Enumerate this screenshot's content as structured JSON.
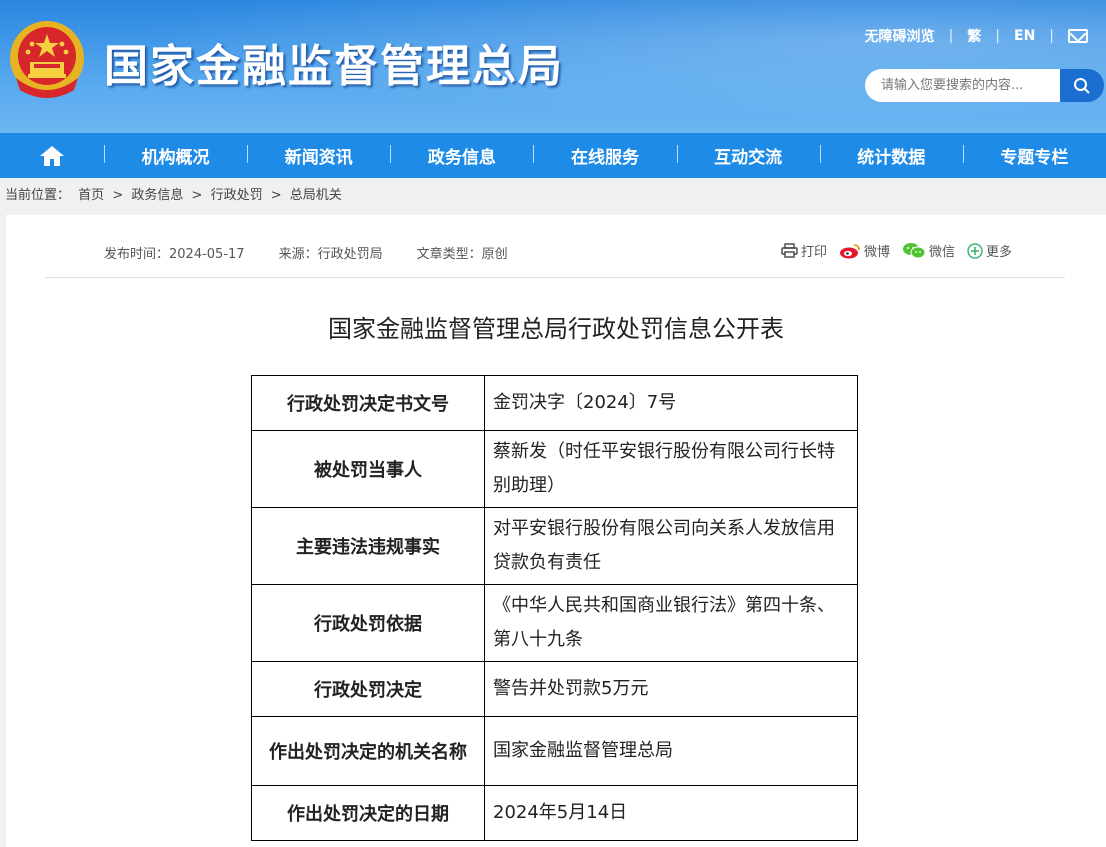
{
  "header": {
    "site_title": "国家金融监督管理总局",
    "top_links": [
      "无障碍浏览",
      "繁",
      "EN"
    ],
    "search_placeholder": "请输入您要搜索的内容...",
    "colors": {
      "header_blue": "#2a86e0",
      "nav_blue": "#1e8be6"
    }
  },
  "nav": {
    "items": [
      "机构概况",
      "新闻资讯",
      "政务信息",
      "在线服务",
      "互动交流",
      "统计数据",
      "专题专栏"
    ]
  },
  "breadcrumb": {
    "prefix": "当前位置：",
    "items": [
      "首页",
      "政务信息",
      "行政处罚",
      "总局机关"
    ],
    "sep": ">"
  },
  "article": {
    "publish": "发布时间：2024-05-17",
    "source": "来源：行政处罚局",
    "type": "文章类型：原创",
    "share": {
      "print": "打印",
      "weibo": "微博",
      "wechat": "微信",
      "more": "更多"
    },
    "title": "国家金融监督管理总局行政处罚信息公开表",
    "rows": [
      {
        "k": "行政处罚决定书文号",
        "v": "金罚决字〔2024〕7号"
      },
      {
        "k": "被处罚当事人",
        "v": "蔡新发（时任平安银行股份有限公司行长特别助理）"
      },
      {
        "k": "主要违法违规事实",
        "v": "对平安银行股份有限公司向关系人发放信用贷款负有责任"
      },
      {
        "k": "行政处罚依据",
        "v": "《中华人民共和国商业银行法》第四十条、第八十九条"
      },
      {
        "k": "行政处罚决定",
        "v": "警告并处罚款5万元"
      },
      {
        "k": "作出处罚决定的机关名称",
        "v": "国家金融监督管理总局"
      },
      {
        "k": "作出处罚决定的日期",
        "v": "2024年5月14日"
      }
    ]
  }
}
